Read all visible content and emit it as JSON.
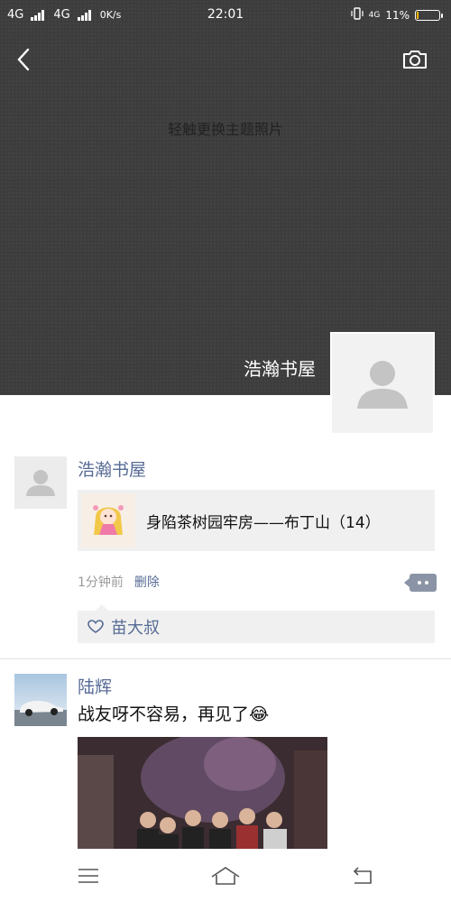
{
  "status_bar": {
    "network1": "4G",
    "network2": "4G",
    "speed": "0K/s",
    "time": "22:01",
    "net_small": "4G",
    "battery_text": "11%",
    "battery_level": 0.11
  },
  "cover": {
    "hint": "轻触更换主题照片",
    "owner_name": "浩瀚书屋",
    "background_color": "#3d3d3d"
  },
  "posts": [
    {
      "author": "浩瀚书屋",
      "link_title": "身陷茶树园牢房——布丁山（14）",
      "time": "1分钟前",
      "delete_label": "删除",
      "likes": [
        "苗大叔"
      ]
    },
    {
      "author": "陆辉",
      "text": "战友呀不容易，再见了😂"
    }
  ],
  "colors": {
    "name_link": "#576b95",
    "meta_gray": "#9a9a9a"
  }
}
